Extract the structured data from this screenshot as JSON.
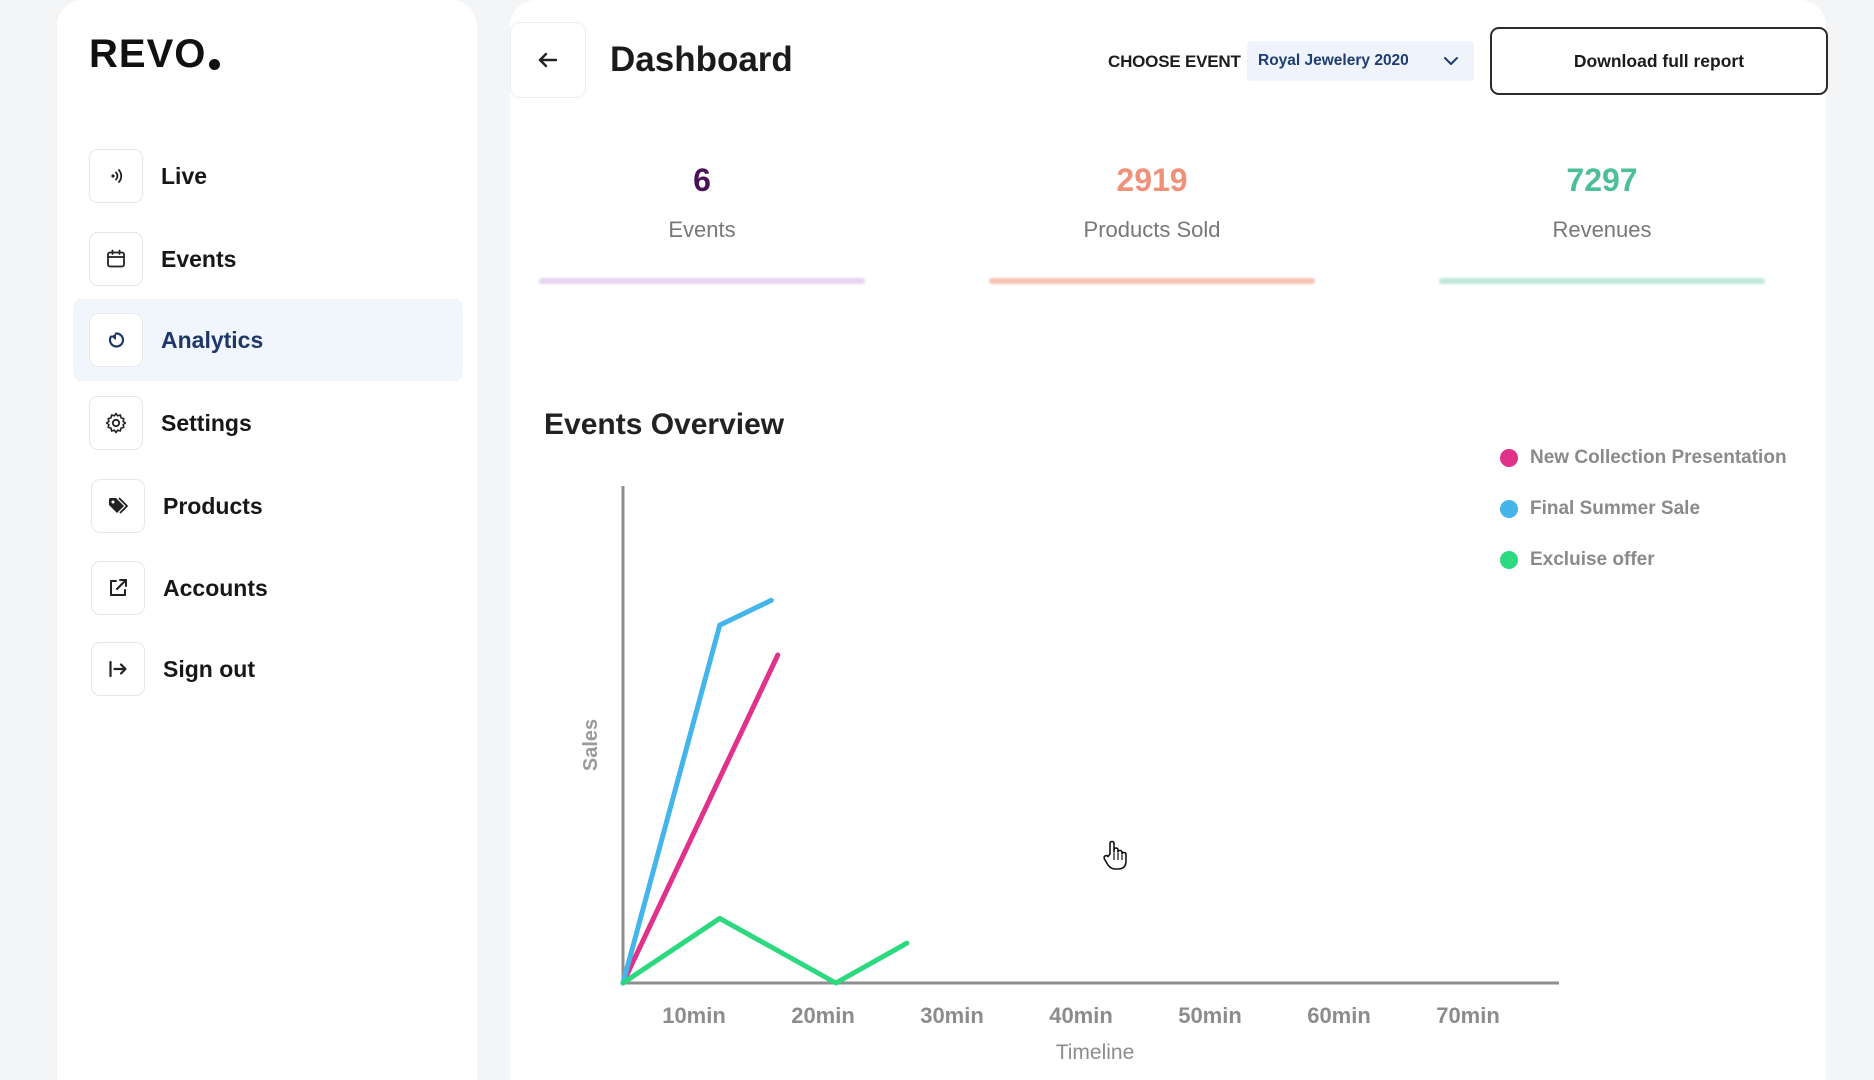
{
  "brand": {
    "name": "REVO"
  },
  "sidebar": {
    "items": [
      {
        "label": "Live",
        "icon": "live-signal-icon",
        "active": false
      },
      {
        "label": "Events",
        "icon": "calendar-icon",
        "active": false
      },
      {
        "label": "Analytics",
        "icon": "analytics-refresh-icon",
        "active": true
      },
      {
        "label": "Settings",
        "icon": "gear-icon",
        "active": false
      },
      {
        "label": "Products",
        "icon": "tag-icon",
        "active": false
      },
      {
        "label": "Accounts",
        "icon": "external-link-icon",
        "active": false
      },
      {
        "label": "Sign out",
        "icon": "sign-out-icon",
        "active": false
      }
    ]
  },
  "header": {
    "title": "Dashboard",
    "choose_event_label": "CHOOSE EVENT",
    "selected_event": "Royal Jewelery 2020",
    "download_label": "Download full report"
  },
  "stats": [
    {
      "value": "6",
      "label": "Events",
      "color": "#4a1259",
      "glow": "#e6d4f0"
    },
    {
      "value": "2919",
      "label": "Products Sold",
      "color": "#f0917a",
      "glow": "#f8c3b4"
    },
    {
      "value": "7297",
      "label": "Revenues",
      "color": "#4cbf9a",
      "glow": "#bfe9da"
    }
  ],
  "chart": {
    "title": "Events Overview"
  },
  "chart_data": {
    "type": "line",
    "xlabel": "Timeline",
    "ylabel": "Sales",
    "x_ticks": [
      "10min",
      "20min",
      "30min",
      "40min",
      "50min",
      "60min",
      "70min"
    ],
    "xlim": [
      0,
      70
    ],
    "ylim": [
      0,
      100
    ],
    "grid": false,
    "legend_position": "top-right",
    "series": [
      {
        "name": "New Collection Presentation",
        "color": "#e0318b",
        "points": [
          [
            0,
            0
          ],
          [
            12,
            66
          ]
        ]
      },
      {
        "name": "Final Summer Sale",
        "color": "#43b5ea",
        "points": [
          [
            0,
            0
          ],
          [
            7.5,
            72
          ],
          [
            11.5,
            77
          ]
        ]
      },
      {
        "name": "Excluise offer",
        "color": "#2cd97f",
        "points": [
          [
            0,
            0
          ],
          [
            7.5,
            13
          ],
          [
            16.5,
            0
          ],
          [
            22,
            8
          ]
        ]
      }
    ]
  }
}
